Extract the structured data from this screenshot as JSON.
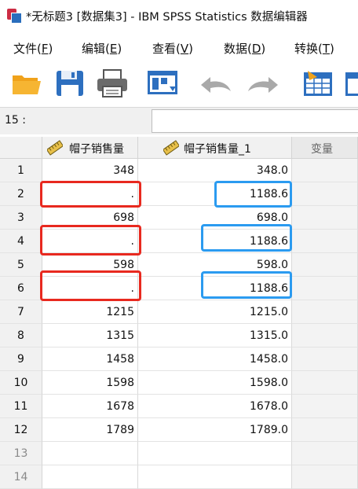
{
  "window": {
    "title": "*无标题3 [数据集3] - IBM SPSS Statistics 数据编辑器"
  },
  "menu": [
    {
      "label": "文件(",
      "key": "F",
      "end": ")"
    },
    {
      "label": "编辑(",
      "key": "E",
      "end": ")"
    },
    {
      "label": "查看(",
      "key": "V",
      "end": ")"
    },
    {
      "label": "数据(",
      "key": "D",
      "end": ")"
    },
    {
      "label": "转换(",
      "key": "T",
      "end": ")"
    }
  ],
  "toolbar": {
    "icons": [
      "open-folder-icon",
      "save-icon",
      "print-icon",
      "recall-dialog-icon",
      "undo-icon",
      "redo-icon",
      "goto-case-icon",
      "variables-icon"
    ]
  },
  "cell_ref": {
    "label": "15 :",
    "value": ""
  },
  "grid": {
    "columns": [
      {
        "name": "帽子销售量",
        "icon": "scale-ruler-icon"
      },
      {
        "name": "帽子销售量_1",
        "icon": "scale-ruler-icon"
      },
      {
        "name": "变量"
      }
    ],
    "rows": [
      {
        "n": "1",
        "a": "348",
        "b": "348.0"
      },
      {
        "n": "2",
        "a": ".",
        "b": "1188.6"
      },
      {
        "n": "3",
        "a": "698",
        "b": "698.0"
      },
      {
        "n": "4",
        "a": ".",
        "b": "1188.6"
      },
      {
        "n": "5",
        "a": "598",
        "b": "598.0"
      },
      {
        "n": "6",
        "a": ".",
        "b": "1188.6"
      },
      {
        "n": "7",
        "a": "1215",
        "b": "1215.0"
      },
      {
        "n": "8",
        "a": "1315",
        "b": "1315.0"
      },
      {
        "n": "9",
        "a": "1458",
        "b": "1458.0"
      },
      {
        "n": "10",
        "a": "1598",
        "b": "1598.0"
      },
      {
        "n": "11",
        "a": "1678",
        "b": "1678.0"
      },
      {
        "n": "12",
        "a": "1789",
        "b": "1789.0"
      },
      {
        "n": "13",
        "a": "",
        "b": ""
      },
      {
        "n": "14",
        "a": "",
        "b": ""
      }
    ]
  },
  "colors": {
    "red_highlight": "#e8291f",
    "blue_highlight": "#2b9bf0"
  }
}
